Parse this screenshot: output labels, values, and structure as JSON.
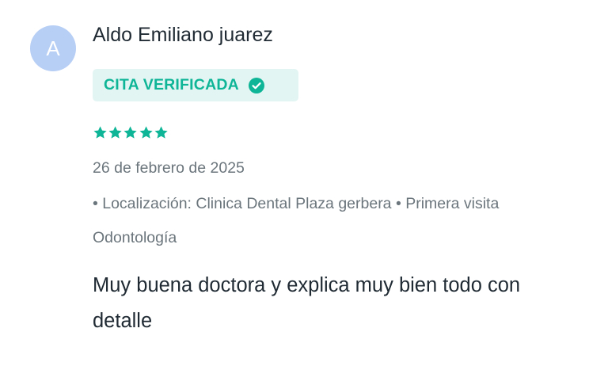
{
  "review": {
    "avatar_initial": "A",
    "reviewer_name": "Aldo Emiliano juarez",
    "badge_label": "CITA VERIFICADA",
    "rating": 5,
    "rating_max": 5,
    "date": "26 de febrero de 2025",
    "details": "• Localización: Clinica Dental Plaza gerbera • Primera visita Odontología",
    "comment": "Muy buena doctora y explica muy bien todo con detalle"
  },
  "colors": {
    "accent": "#0fb597",
    "badge_background": "#e3f5f3",
    "avatar_background": "#b7cef5",
    "muted_text": "#6b757c",
    "primary_text": "#1f2a33"
  },
  "icons": {
    "verified": "check-circle-icon",
    "rating": "star-icon"
  }
}
